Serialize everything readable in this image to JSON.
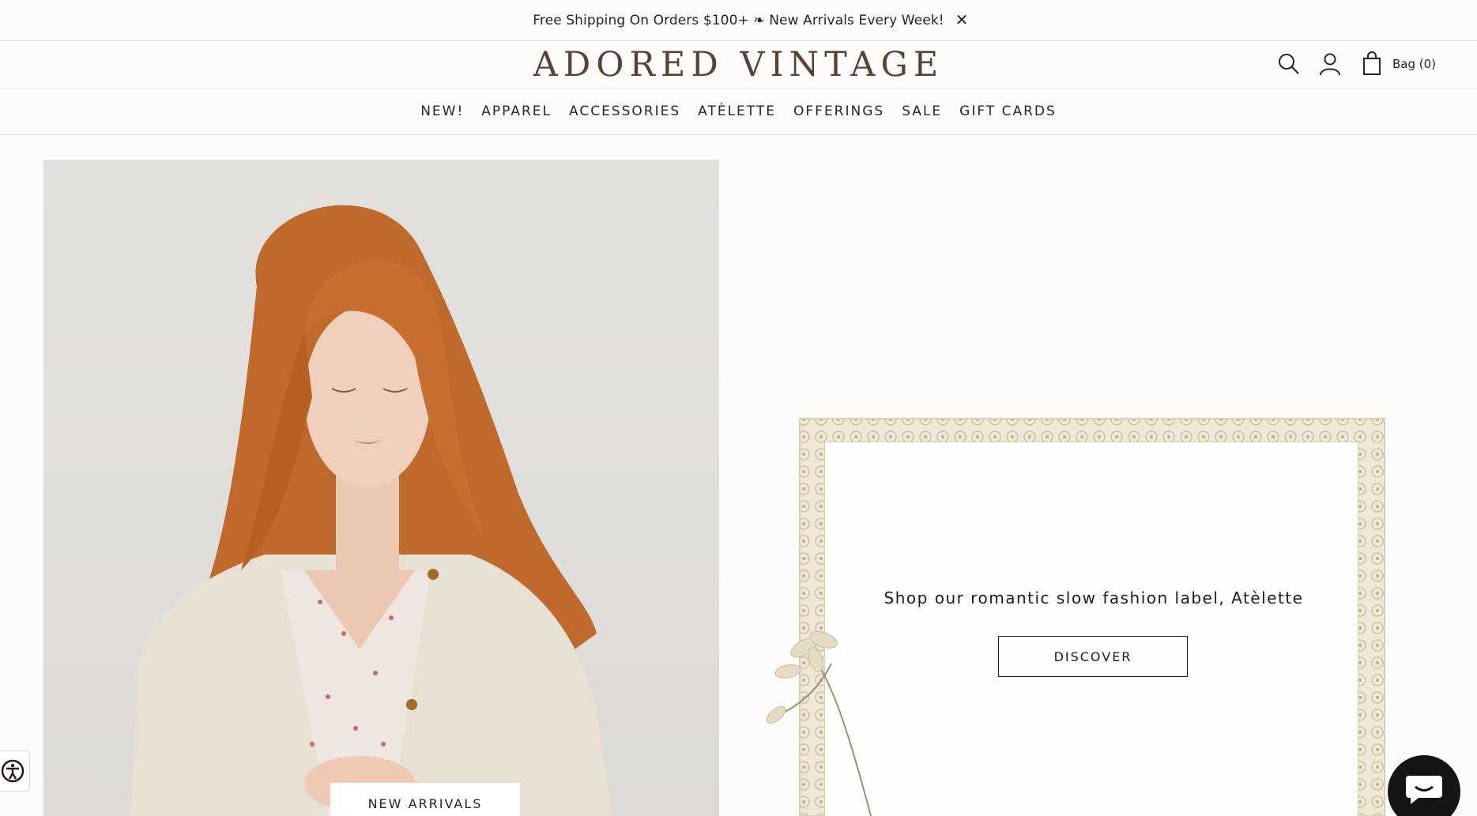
{
  "announcement": {
    "text": "Free Shipping On Orders $100+ ❧ New Arrivals Every Week!",
    "close_icon": "close-icon"
  },
  "header": {
    "logo": "ADORED VINTAGE",
    "bag_label": "Bag (0)",
    "icons": [
      "search-icon",
      "account-icon",
      "bag-icon"
    ]
  },
  "nav": {
    "items": [
      "NEW!",
      "APPAREL",
      "ACCESSORIES",
      "ATÈLETTE",
      "OFFERINGS",
      "SALE",
      "GIFT CARDS"
    ]
  },
  "hero_left": {
    "button_label": "NEW ARRIVALS"
  },
  "hero_right": {
    "text": "Shop our romantic slow fashion label, Atèlette",
    "button_label": "DISCOVER"
  },
  "colors": {
    "background": "#fdfcfa",
    "logo": "#5a4233",
    "text": "#2b2420",
    "chat": "#151515"
  }
}
